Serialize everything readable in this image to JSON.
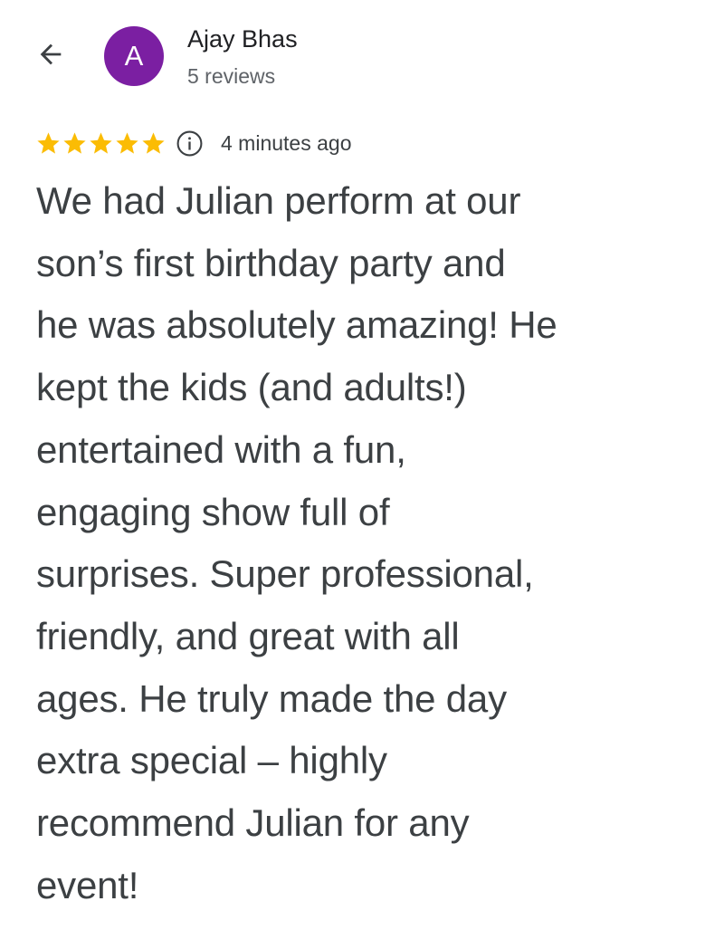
{
  "header": {
    "back_icon": "arrow-back-icon",
    "avatar_letter": "A",
    "avatar_color": "#7b1fa2",
    "reviewer_name": "Ajay Bhas",
    "review_count": "5 reviews"
  },
  "review": {
    "rating": 5,
    "max_rating": 5,
    "star_color": "#fbbc04",
    "info_icon": "info-icon",
    "timestamp": "4 minutes ago",
    "text": "We had Julian perform at our\nson’s first birthday party and\nhe was absolutely amazing! He\nkept the kids (and adults!)\nentertained with a fun,\nengaging show full of\nsurprises. Super professional,\nfriendly, and great with all\nages. He truly made the day\nextra special – highly\nrecommend Julian for any\nevent!"
  }
}
